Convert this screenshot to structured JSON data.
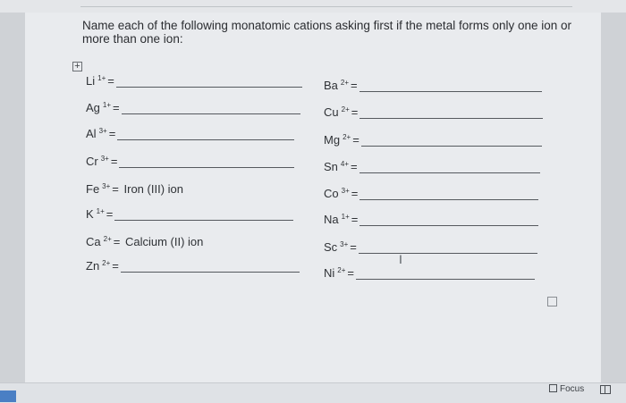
{
  "question": "Name each of the following monatomic cations asking first if the metal forms only one ion or more than one ion:",
  "icons": {
    "table_handle": "table-move-handle-icon",
    "cursor": "text-cursor-icon",
    "focus": "focus-mode-icon",
    "view": "read-view-icon"
  },
  "table": {
    "rows": [
      {
        "symbol": "Li",
        "charge": "1+",
        "equals": "=",
        "answer": ""
      },
      {
        "symbol": "Ag",
        "charge": "1+",
        "equals": "=",
        "answer": ""
      },
      {
        "symbol": "Al",
        "charge": "3+",
        "equals": "=",
        "answer": ""
      },
      {
        "symbol": "Cr",
        "charge": "3+",
        "equals": "=",
        "answer": ""
      },
      {
        "symbol": "Fe",
        "charge": "3+",
        "equals": "=",
        "answer": "Iron (III) ion"
      },
      {
        "symbol": "K",
        "charge": "1+",
        "equals": "=",
        "answer": ""
      },
      {
        "symbol": "Ca",
        "charge": "2+",
        "equals": "=",
        "answer": "Calcium (II) ion"
      },
      {
        "symbol": "Zn",
        "charge": "2+",
        "equals": "=",
        "answer": ""
      },
      {
        "symbol": "Ba",
        "charge": "2+",
        "equals": "=",
        "answer": ""
      },
      {
        "symbol": "Cu",
        "charge": "2+",
        "equals": "=",
        "answer": ""
      },
      {
        "symbol": "Mg",
        "charge": "2+",
        "equals": "=",
        "answer": ""
      },
      {
        "symbol": "Sn",
        "charge": "4+",
        "equals": "=",
        "answer": ""
      },
      {
        "symbol": "Co",
        "charge": "3+",
        "equals": "=",
        "answer": ""
      },
      {
        "symbol": "Na",
        "charge": "1+",
        "equals": "=",
        "answer": ""
      },
      {
        "symbol": "Sc",
        "charge": "3+",
        "equals": "=",
        "answer": ""
      },
      {
        "symbol": "Ni",
        "charge": "2+",
        "equals": "=",
        "answer": ""
      }
    ]
  },
  "statusbar": {
    "focus_label": "Focus"
  }
}
